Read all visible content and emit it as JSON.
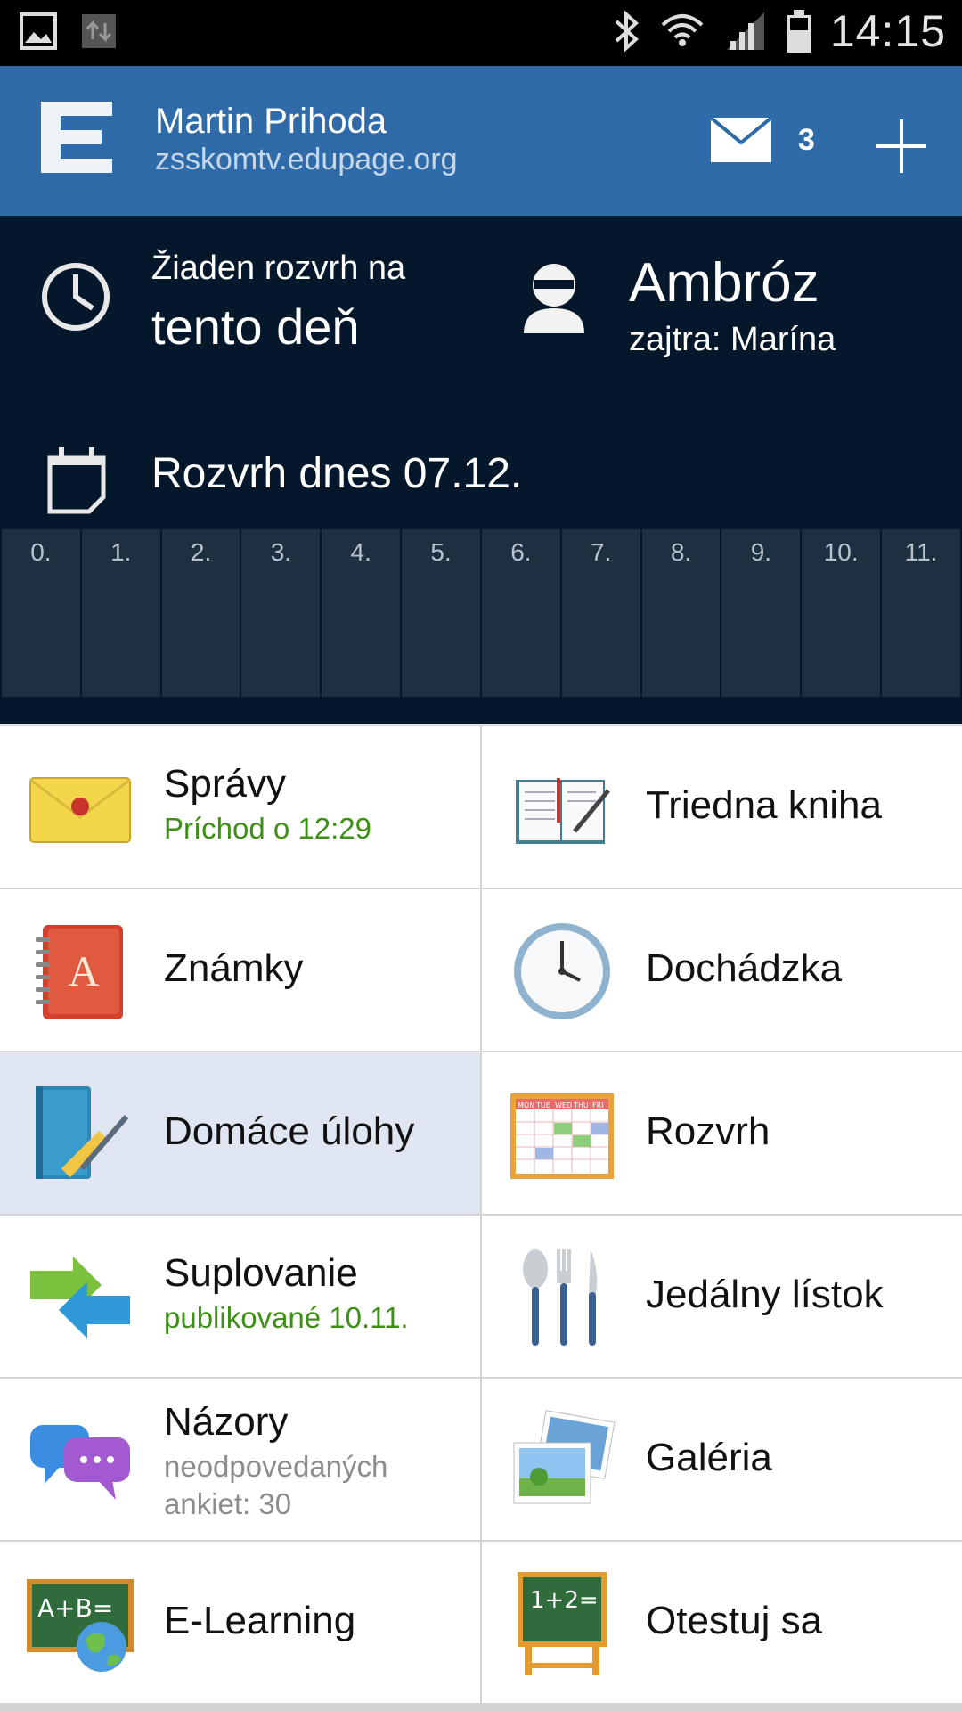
{
  "status_bar": {
    "time": "14:15",
    "icons": [
      "gallery-icon",
      "transfer-icon",
      "bluetooth-icon",
      "wifi-icon",
      "signal-icon",
      "battery-icon"
    ]
  },
  "app_bar": {
    "user_name": "Martin Prihoda",
    "domain": "zsskomtv.edupage.org",
    "mail_count": "3",
    "colors": {
      "bar": "#2f6ba8"
    }
  },
  "dashboard": {
    "timetable_line1": "Žiaden rozvrh na",
    "timetable_line2": "tento deň",
    "nameday_today": "Ambróz",
    "nameday_tomorrow": "zajtra: Marína",
    "schedule_title": "Rozvrh dnes 07.12.",
    "periods": [
      "0.",
      "1.",
      "2.",
      "3.",
      "4.",
      "5.",
      "6.",
      "7.",
      "8.",
      "9.",
      "10.",
      "11."
    ]
  },
  "tiles": [
    {
      "id": "spravy",
      "title": "Správy",
      "subtitle": "Príchod o 12:29"
    },
    {
      "id": "triedna-kniha",
      "title": "Triedna kniha"
    },
    {
      "id": "znamky",
      "title": "Známky"
    },
    {
      "id": "dochadzka",
      "title": "Dochádzka"
    },
    {
      "id": "domace-ulohy",
      "title": "Domáce úlohy"
    },
    {
      "id": "rozvrh",
      "title": "Rozvrh"
    },
    {
      "id": "suplovanie",
      "title": "Suplovanie",
      "subtitle": "publikované 10.11."
    },
    {
      "id": "jedalny-listok",
      "title": "Jedálny lístok"
    },
    {
      "id": "nazory",
      "title": "Názory",
      "subtitle_line1": "neodpovedaných",
      "subtitle_line2": "ankiet: 30"
    },
    {
      "id": "galeria",
      "title": "Galéria"
    },
    {
      "id": "e-learning",
      "title": "E-Learning"
    },
    {
      "id": "otestuj-sa",
      "title": "Otestuj sa"
    }
  ],
  "timetable_header": [
    "MON",
    "TUE",
    "WED",
    "THU",
    "FRI"
  ],
  "icon_text": {
    "elearning_board": "A+B=",
    "test_board": "1+2="
  }
}
